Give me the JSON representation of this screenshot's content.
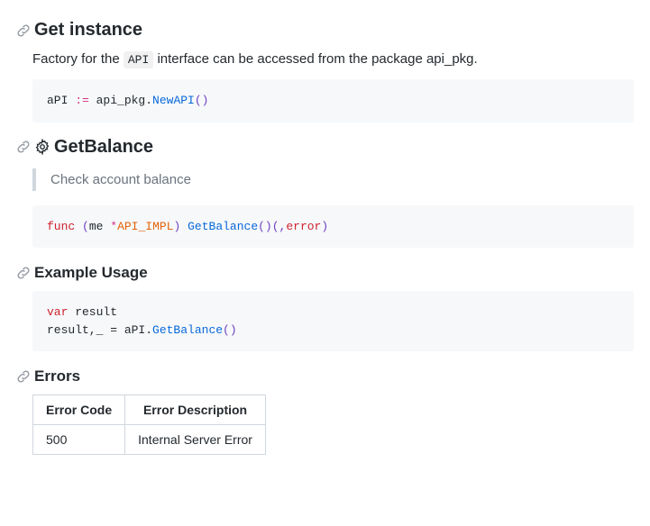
{
  "sections": {
    "getInstance": {
      "title": "Get instance",
      "desc_pre": "Factory for the ",
      "desc_code": "API",
      "desc_post": " interface can be accessed from the package api_pkg.",
      "code": {
        "var": "aPI ",
        "op": ":=",
        "mid": " api_pkg.",
        "fn": "NewAPI",
        "tail": "()"
      }
    },
    "getBalance": {
      "title": "GetBalance",
      "quote": "Check account balance",
      "code": {
        "kw": "func",
        "sp1": " ",
        "p1": "(",
        "recv": "me ",
        "star": "*",
        "ty": "API_IMPL",
        "p2": ")",
        "sp2": " ",
        "fn": "GetBalance",
        "sig1": "()(,",
        "err": "error",
        "sig2": ")"
      }
    },
    "exampleUsage": {
      "title": "Example Usage",
      "code": {
        "kw": "var",
        "line1rest": " result ",
        "line2a": "result,_ = aPI.",
        "fn": "GetBalance",
        "line2b": "()"
      }
    },
    "errors": {
      "title": "Errors",
      "headers": {
        "code": "Error Code",
        "desc": "Error Description"
      },
      "rows": [
        {
          "code": "500",
          "desc": "Internal Server Error"
        }
      ]
    }
  }
}
